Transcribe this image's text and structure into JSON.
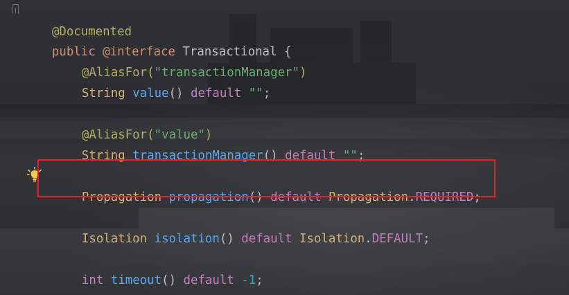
{
  "editor": {
    "lines": [
      {
        "id": "l1",
        "tokens": [
          "@Documented"
        ]
      },
      {
        "id": "l2",
        "tokens": [
          "public",
          " ",
          "@interface",
          " ",
          "Transactional",
          " {"
        ]
      },
      {
        "id": "l3",
        "tokens": [
          "@AliasFor(",
          "\"transactionManager\"",
          ")"
        ]
      },
      {
        "id": "l4",
        "tokens": [
          "String",
          " ",
          "value",
          "() ",
          "default",
          " ",
          "\"\"",
          ";"
        ]
      },
      {
        "id": "l5",
        "tokens": [
          "@AliasFor(",
          "\"value\"",
          ")"
        ]
      },
      {
        "id": "l6",
        "tokens": [
          "String",
          " ",
          "transactionManager",
          "() ",
          "default",
          " ",
          "\"\"",
          ";"
        ]
      },
      {
        "id": "l7",
        "tokens": [
          "Propagation",
          " ",
          "propagation",
          "() ",
          "default",
          " ",
          "Propagation",
          ".",
          "REQUIRED",
          ";"
        ]
      },
      {
        "id": "l8",
        "tokens": [
          "Isolation",
          " ",
          "isolation",
          "() ",
          "default",
          " ",
          "Isolation",
          ".",
          "DEFAULT",
          ";"
        ]
      },
      {
        "id": "l9",
        "tokens": [
          "int",
          " ",
          "timeout",
          "() ",
          "default",
          " ",
          "-1",
          ";"
        ]
      }
    ]
  },
  "colors": {
    "highlight_border": "#e0242c",
    "annotation": "#b3ae60",
    "keyword": "#cf8e6d",
    "default_keyword": "#c77dbb",
    "method": "#56a8f5",
    "string": "#6aab73",
    "type": "#d3b07a",
    "number": "#2aacb8"
  },
  "icons": {
    "gutter": "fold-marker-icon",
    "intention": "lightbulb-icon"
  }
}
